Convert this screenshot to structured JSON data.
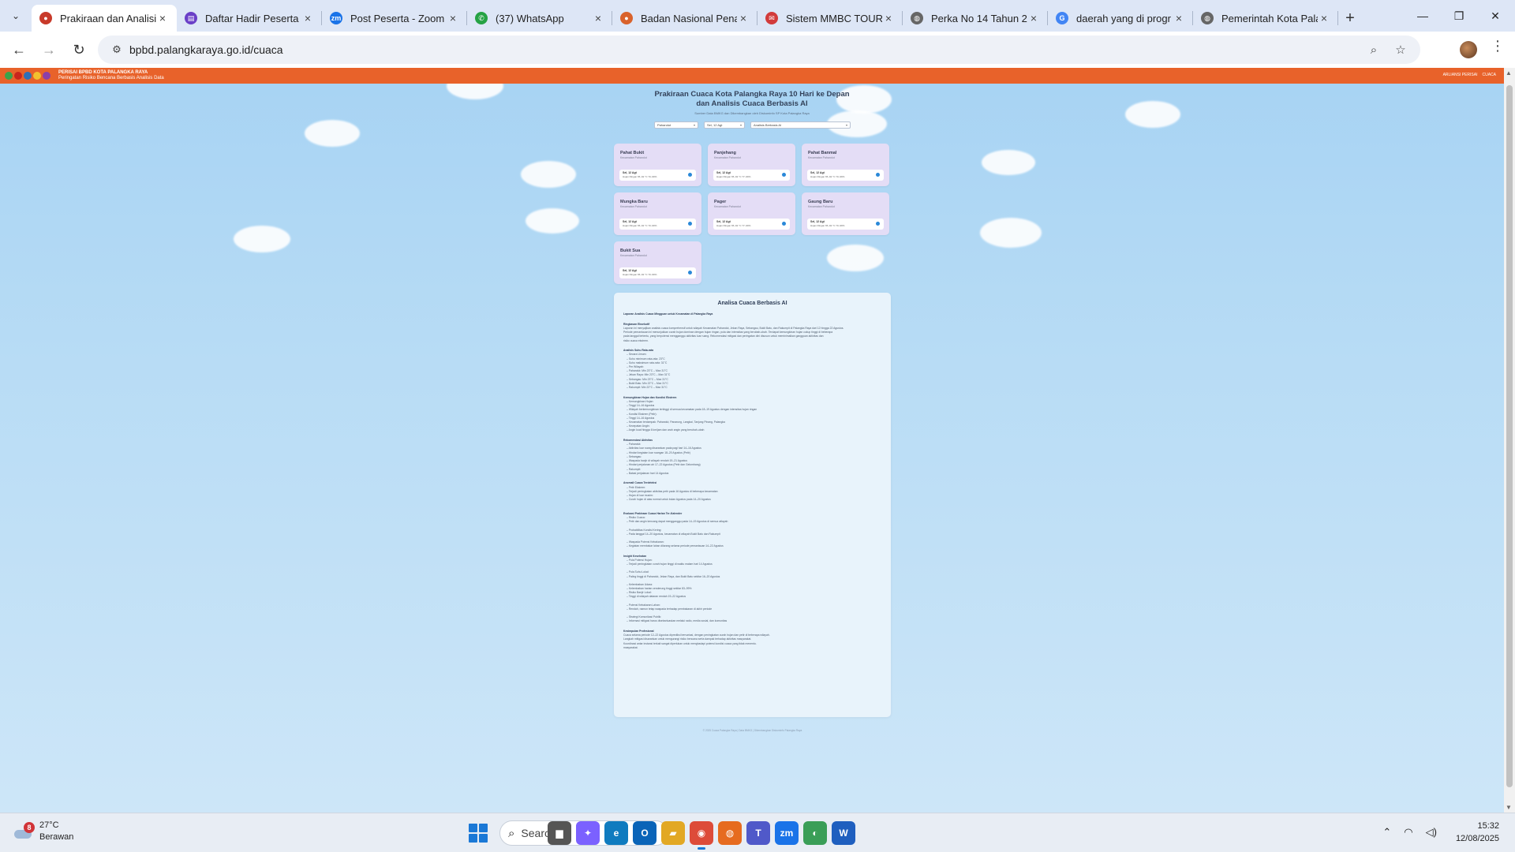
{
  "browser": {
    "tabs": [
      {
        "title": "Prakiraan dan Analisis",
        "color": "#c83a2a",
        "glyph": "●"
      },
      {
        "title": "Daftar Hadir Peserta V",
        "color": "#6a3fc7",
        "glyph": "▤"
      },
      {
        "title": "Post Peserta - Zoom",
        "color": "#1a73e8",
        "glyph": "zm"
      },
      {
        "title": "(37) WhatsApp",
        "color": "#25a244",
        "glyph": "✆"
      },
      {
        "title": "Badan Nasional Penan",
        "color": "#d9622b",
        "glyph": "●"
      },
      {
        "title": "Sistem MMBC TOUR",
        "color": "#d23b3b",
        "glyph": "✉"
      },
      {
        "title": "Perka No 14 Tahun 20",
        "color": "#666666",
        "glyph": "◍"
      },
      {
        "title": "daerah yang di progr",
        "color": "#4285f4",
        "glyph": "G"
      },
      {
        "title": "Pemerintah Kota Pala",
        "color": "#666666",
        "glyph": "◍"
      }
    ],
    "url": "bpbd.palangkaraya.go.id/cuaca"
  },
  "site": {
    "brand_line1": "PERISAI BPBD KOTA PALANGKA RAYA",
    "brand_line2": "Peringatan Risiko Bencana Berbasis Analisis Data",
    "nav_links": [
      "ARLIANSI PERISAI",
      "CUACA"
    ],
    "hero_title_line1": "Prakiraan Cuaca Kota Palangka Raya 10 Hari ke Depan",
    "hero_title_line2": "dan Analisis Cuaca Berbasis AI",
    "hero_subtitle": "Sumber Data BMKG dan Dikembangkan oleh Diskominfo SP Kota Palangka Raya",
    "filter_kecamatan": "Pahandut",
    "filter_date": "Sel, 12 Agt",
    "filter_analysis": "Analisis Berbasis AI"
  },
  "cards": [
    {
      "name": "Pahat Bukit",
      "sub": "Kecamatan Pahandut",
      "date": "Sel, 12 Agt",
      "rain": "Hujan Ringan 65–92 °C 70–99%"
    },
    {
      "name": "Panjehang",
      "sub": "Kecamatan Pahandut",
      "date": "Sel, 12 Agt",
      "rain": "Hujan Ringan 65–92 °C 77–99%"
    },
    {
      "name": "Pahat Banmal",
      "sub": "Kecamatan Pahandut",
      "date": "Sel, 12 Agt",
      "rain": "Hujan Ringan 65–92 °C 70–99%"
    },
    {
      "name": "Mungka Baru",
      "sub": "Kecamatan Pahandut",
      "date": "Sel, 12 Agt",
      "rain": "Hujan Ringan 65–92 °C 70–99%"
    },
    {
      "name": "Pager",
      "sub": "Kecamatan Pahandut",
      "date": "Sel, 12 Agt",
      "rain": "Hujan Ringan 65–92 °C 77–99%"
    },
    {
      "name": "Gaung Baru",
      "sub": "Kecamatan Pahandut",
      "date": "Sel, 12 Agt",
      "rain": "Hujan Ringan 65–92 °C 70–99%"
    },
    {
      "name": "Bukit Sua",
      "sub": "Kecamatan Pahandut",
      "date": "Sel, 12 Agt",
      "rain": "Hujan Ringan 65–92 °C 70–99%"
    }
  ],
  "analysis": {
    "title": "Analisa Cuaca Berbasis AI",
    "lines": [
      {
        "t": "Laporan Analisis Cuaca Mingguan untuk Kecamatan di Palangka Raya",
        "k": "h"
      },
      {
        "t": "",
        "k": "gap"
      },
      {
        "t": "Ringkasan Eksekutif",
        "k": "h"
      },
      {
        "t": "Laporan ini menyajikan analisis cuaca komprehensif untuk wilayah Kecamatan Pahandut, Jekan Raya, Sebangau, Bukit Batu, dan Rakumpit di Palangka Raya dari 12 hingga 22 Agustus.",
        "k": "n"
      },
      {
        "t": "Periode pemantauan ini menunjukkan curah hujan dominan dengan hujan ringan, pola dan intensitas yang berubah-ubah. Terdapat kemungkinan hujan cukup tinggi di beberapa",
        "k": "n"
      },
      {
        "t": "pada tanggal tertentu, yang berpotensi mengganggu aktivitas luar ruang. Rekomendasi mitigasi dan peringatan dini disusun untuk meminimalkan gangguan aktivitas dan",
        "k": "n"
      },
      {
        "t": "risiko cuaca ekstrem.",
        "k": "n"
      },
      {
        "t": "",
        "k": "gap"
      },
      {
        "t": "Analisis Suhu Rata-rata",
        "k": "h"
      },
      {
        "t": "– Secara Umum:",
        "k": "i"
      },
      {
        "t": "– Suhu minimum rata-rata: 23°C",
        "k": "i"
      },
      {
        "t": "– Suhu maksimum rata-rata: 31°C",
        "k": "i"
      },
      {
        "t": "– Per Wilayah:",
        "k": "i"
      },
      {
        "t": "– Pahandut: Min 23°C – Max 31°C",
        "k": "i"
      },
      {
        "t": "– Jekan Raya: Min 23°C – Max 31°C",
        "k": "i"
      },
      {
        "t": "– Sebangau: Min 23°C – Max 31°C",
        "k": "i"
      },
      {
        "t": "– Bukit Batu: Min 22°C – Max 31°C",
        "k": "i"
      },
      {
        "t": "– Rakumpit: Min 22°C – Max 31°C",
        "k": "i"
      },
      {
        "t": "",
        "k": "gap"
      },
      {
        "t": "Kemungkinan Hujan dan Kondisi Ekstrem",
        "k": "h"
      },
      {
        "t": "– Kemungkinan Hujan:",
        "k": "i"
      },
      {
        "t": "– Tinggi 14–16 Agustus",
        "k": "i"
      },
      {
        "t": "– Wilayah berkemungkinan tertinggi di semua kecamatan pada 18–19 Agustus dengan intensitas hujan ringan",
        "k": "i"
      },
      {
        "t": "– Kondisi Ekstrem (Petir):",
        "k": "i"
      },
      {
        "t": "– Tinggi 14–16 Agustus",
        "k": "i"
      },
      {
        "t": "– Kecamatan terdampak: Pahandut, Panarung, Langkai, Tanjung Pinang, Palangka",
        "k": "i"
      },
      {
        "t": "– Kecepatan Angin:",
        "k": "i"
      },
      {
        "t": "– Angin kuat hingga 6 km/jam dan arah angin yang berubah-ubah",
        "k": "i"
      },
      {
        "t": "",
        "k": "gap"
      },
      {
        "t": "Rekomendasi Aktivitas",
        "k": "h"
      },
      {
        "t": "– Pahandut:",
        "k": "i"
      },
      {
        "t": "– Aktivitas luar ruang disarankan pada pagi hari 14–16 Agustus",
        "k": "i"
      },
      {
        "t": "– Hindari kegiatan luar ruangan 18–20 Agustus (Petir)",
        "k": "i"
      },
      {
        "t": "– Sebangau:",
        "k": "i"
      },
      {
        "t": "– Waspada banjir di wilayah rendah 19–21 Agustus",
        "k": "i"
      },
      {
        "t": "– Hindari perjalanan air 17–22 Agustus (Petir dan Gelombang)",
        "k": "i"
      },
      {
        "t": "– Rakumpit:",
        "k": "i"
      },
      {
        "t": "– Batasi perjalanan hari 14 Agustus",
        "k": "i"
      },
      {
        "t": "",
        "k": "gap"
      },
      {
        "t": "Anomali Cuaca Terdeteksi",
        "k": "h"
      },
      {
        "t": "– Petir Ekstrem:",
        "k": "i"
      },
      {
        "t": "– Terjadi peningkatan aktivitas petir pada 16 Agustus di beberapa kecamatan",
        "k": "i"
      },
      {
        "t": "– Hujan di luar musim:",
        "k": "i"
      },
      {
        "t": "– Curah hujan di atas normal untuk bulan Agustus pada 14–20 Agustus",
        "k": "i"
      },
      {
        "t": "",
        "k": "gap"
      },
      {
        "t": "",
        "k": "gap"
      },
      {
        "t": "Evaluasi Prakiraan Cuaca Harian Ter-Kalender",
        "k": "h"
      },
      {
        "t": "– Risiko Cuaca:",
        "k": "i"
      },
      {
        "t": "– Petir dan angin kencang dapat mengganggu pada 14–19 Agustus di semua wilayah",
        "k": "i"
      },
      {
        "t": "",
        "k": "gap"
      },
      {
        "t": "– Probabilitas Kondisi Kering:",
        "k": "i"
      },
      {
        "t": "– Pada tanggal 14–20 Agustus, kecamatan di wilayah Bukit Batu dan Rakumpit",
        "k": "i"
      },
      {
        "t": "",
        "k": "gap"
      },
      {
        "t": "– Waspada Potensi Kebakaran:",
        "k": "i"
      },
      {
        "t": "– Kegiatan membakar lahan dilarang selama periode pemantauan 14–22 Agustus",
        "k": "i"
      },
      {
        "t": "",
        "k": "gap"
      },
      {
        "t": "Insight Kesehatan",
        "k": "h"
      },
      {
        "t": "– Pola Potensi Hujan:",
        "k": "i"
      },
      {
        "t": "– Terjadi peningkatan curah hujan tinggi di waktu malam hari 14 Agustus",
        "k": "i"
      },
      {
        "t": "",
        "k": "gap"
      },
      {
        "t": "– Pola Suhu Lokal:",
        "k": "i"
      },
      {
        "t": "– Paling tinggi di Pahandut, Jekan Raya, dan Bukit Batu sekitar 16–20 Agustus",
        "k": "i"
      },
      {
        "t": "",
        "k": "gap"
      },
      {
        "t": "– Kelembaban Udara:",
        "k": "i"
      },
      {
        "t": "– Kelembaban harian cenderung tinggi sekitar 83–99%",
        "k": "i"
      },
      {
        "t": "– Risiko Banjir Lokal:",
        "k": "i"
      },
      {
        "t": "– Tinggi di wilayah dataran rendah 19–22 Agustus",
        "k": "i"
      },
      {
        "t": "",
        "k": "gap"
      },
      {
        "t": "– Potensi Kebakaran Lahan:",
        "k": "i"
      },
      {
        "t": "– Rendah, namun tetap waspada terhadap pembakaran di akhir periode",
        "k": "i"
      },
      {
        "t": "",
        "k": "gap"
      },
      {
        "t": "– Strategi Komunikasi Publik:",
        "k": "i"
      },
      {
        "t": "– Informasi mitigasi harus disebarluaskan melalui radio, media sosial, dan komunitas",
        "k": "i"
      },
      {
        "t": "",
        "k": "gap"
      },
      {
        "t": "Kesimpulan Profesional",
        "k": "h"
      },
      {
        "t": "Cuaca selama periode 12–22 Agustus diprediksi bervariasi, dengan peningkatan curah hujan dan petir di beberapa wilayah.",
        "k": "n"
      },
      {
        "t": "Langkah mitigasi disarankan untuk mengurangi risiko bencana serta dampak terhadap aktivitas masyarakat.",
        "k": "n"
      },
      {
        "t": "Koordinasi antar instansi terkait sangat diperlukan untuk menghadapi potensi kondisi cuaca yang tidak menentu.",
        "k": "n"
      },
      {
        "t": "masyarakat.",
        "k": "n"
      }
    ]
  },
  "footer": "© 2025 Cuaca Palangka Raya | Data BMKG | Dikembangkan Diskominfo Palangka Raya",
  "taskbar": {
    "weather_temp": "27°C",
    "weather_desc": "Berawan",
    "weather_badge": "8",
    "search_placeholder": "Search",
    "time": "15:32",
    "date": "12/08/2025",
    "apps": [
      {
        "name": "file-explorer-app",
        "glyph": "▆",
        "color": "#555555"
      },
      {
        "name": "copilot-app",
        "glyph": "✦",
        "color": "#7b61ff"
      },
      {
        "name": "edge-app",
        "glyph": "e",
        "color": "#0f7bbf"
      },
      {
        "name": "outlook-app",
        "glyph": "O",
        "color": "#0a64b8"
      },
      {
        "name": "folder-app",
        "glyph": "▰",
        "color": "#e2a824"
      },
      {
        "name": "chrome-app",
        "glyph": "◉",
        "color": "#dd4b39"
      },
      {
        "name": "firefox-app",
        "glyph": "◍",
        "color": "#e66b1f"
      },
      {
        "name": "teams-app",
        "glyph": "T",
        "color": "#5059c9"
      },
      {
        "name": "zoom-app",
        "glyph": "zm",
        "color": "#1a73e8"
      },
      {
        "name": "maps-app",
        "glyph": "◐",
        "color": "#3a9e57"
      },
      {
        "name": "word-app",
        "glyph": "W",
        "color": "#1f5fbf"
      }
    ]
  }
}
